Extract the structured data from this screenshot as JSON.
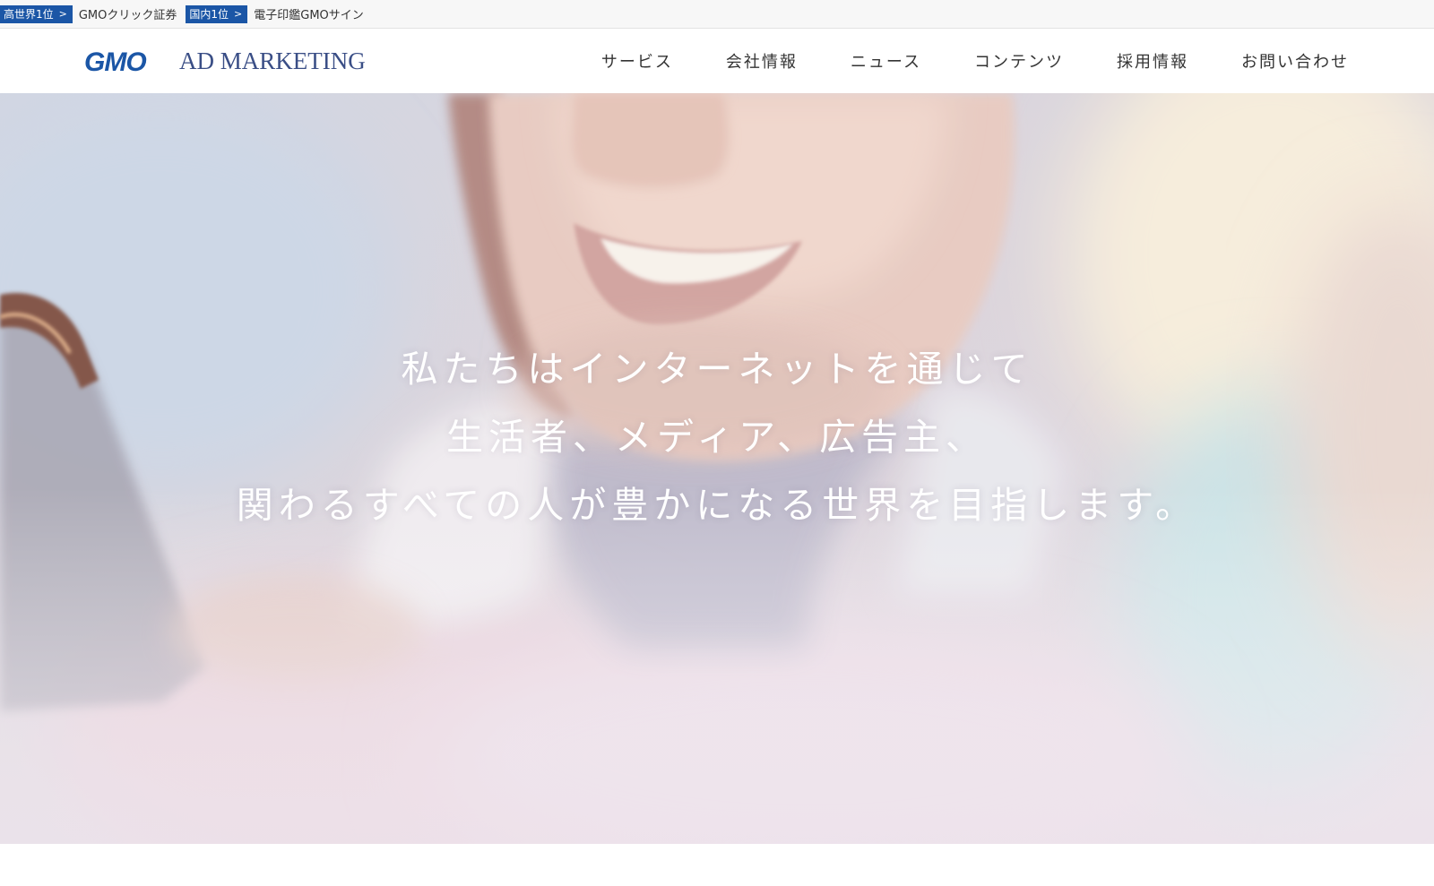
{
  "promo": [
    {
      "badge": "高世界1位",
      "arrow": ">",
      "text": "GMOクリック証券"
    },
    {
      "badge": "国内1位",
      "arrow": ">",
      "text": "電子印鑑GMOサイン"
    }
  ],
  "header": {
    "logo_brand": "GMO",
    "logo_suffix": "AD MARKETING",
    "nav": [
      "サービス",
      "会社情報",
      "ニュース",
      "コンテンツ",
      "採用情報",
      "お問い合わせ"
    ]
  },
  "hero": {
    "lines": [
      "私たちはインターネットを通じて",
      "生活者、メディア、広告主、",
      "関わるすべての人が豊かになる世界を目指します。"
    ]
  },
  "colors": {
    "brand_blue": "#1b56a6",
    "logo_navy": "#3a4e86"
  }
}
